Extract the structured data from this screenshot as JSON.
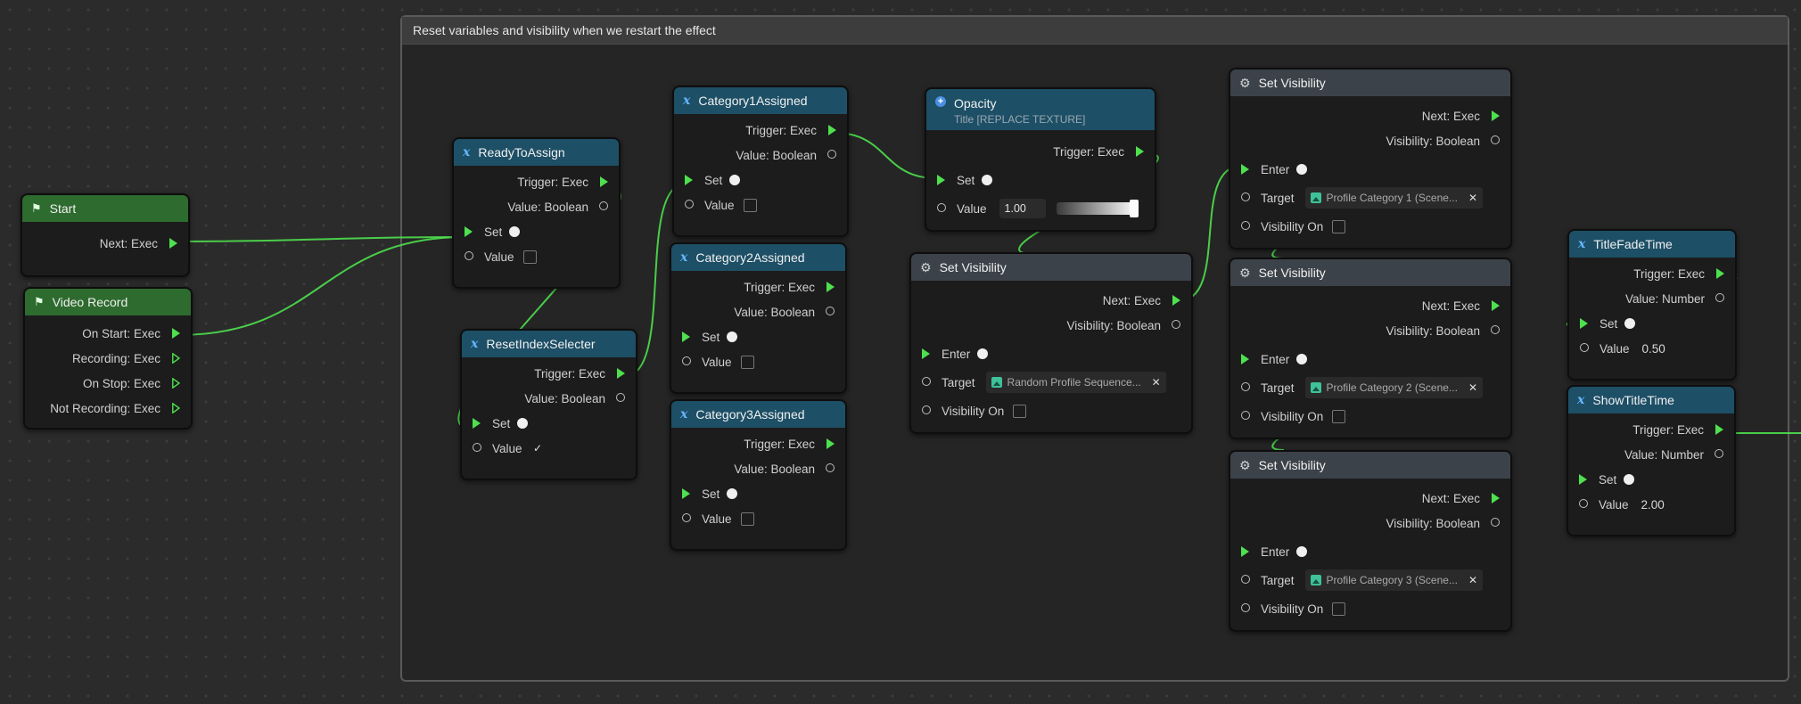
{
  "comment": {
    "title": "Reset variables and visibility when we restart the effect"
  },
  "colors": {
    "exec_pin": "#4ee04e",
    "wire": "#4ee04e",
    "header_green": "#2e6b2e",
    "header_teal": "#1d4f66",
    "header_gray": "#3c4249"
  },
  "nodes": {
    "start": {
      "title": "Start",
      "icon": "flag-icon",
      "next": "Next: Exec"
    },
    "video_record": {
      "title": "Video Record",
      "icon": "flag-icon",
      "on_start": "On Start: Exec",
      "recording": "Recording: Exec",
      "on_stop": "On Stop: Exec",
      "not_recording": "Not Recording: Exec"
    },
    "ready_to_assign": {
      "title": "ReadyToAssign",
      "trigger": "Trigger: Exec",
      "value_type": "Value: Boolean",
      "set": "Set",
      "value": "Value",
      "checked": false
    },
    "reset_index": {
      "title": "ResetIndexSelecter",
      "trigger": "Trigger: Exec",
      "value_type": "Value: Boolean",
      "set": "Set",
      "value": "Value",
      "checked": true
    },
    "cat1": {
      "title": "Category1Assigned",
      "trigger": "Trigger: Exec",
      "value_type": "Value: Boolean",
      "set": "Set",
      "value": "Value",
      "checked": false
    },
    "cat2": {
      "title": "Category2Assigned",
      "trigger": "Trigger: Exec",
      "value_type": "Value: Boolean",
      "set": "Set",
      "value": "Value",
      "checked": false
    },
    "cat3": {
      "title": "Category3Assigned",
      "trigger": "Trigger: Exec",
      "value_type": "Value: Boolean",
      "set": "Set",
      "value": "Value",
      "checked": false
    },
    "opacity": {
      "title": "Opacity",
      "subtitle": "Title [REPLACE TEXTURE]",
      "trigger": "Trigger: Exec",
      "set": "Set",
      "value": "Value",
      "value_num": "1.00",
      "slider_level": 1.0
    },
    "sv_main": {
      "title": "Set Visibility",
      "next": "Next: Exec",
      "vis_type": "Visibility: Boolean",
      "enter": "Enter",
      "target": "Target",
      "target_value": "Random Profile Sequence...",
      "vis_on": "Visibility On"
    },
    "sv1": {
      "title": "Set Visibility",
      "next": "Next: Exec",
      "vis_type": "Visibility: Boolean",
      "enter": "Enter",
      "target": "Target",
      "target_value": "Profile Category 1 (Scene...",
      "vis_on": "Visibility On"
    },
    "sv2": {
      "title": "Set Visibility",
      "next": "Next: Exec",
      "vis_type": "Visibility: Boolean",
      "enter": "Enter",
      "target": "Target",
      "target_value": "Profile Category 2 (Scene...",
      "vis_on": "Visibility On"
    },
    "sv3": {
      "title": "Set Visibility",
      "next": "Next: Exec",
      "vis_type": "Visibility: Boolean",
      "enter": "Enter",
      "target": "Target",
      "target_value": "Profile Category 3 (Scene...",
      "vis_on": "Visibility On"
    },
    "title_fade": {
      "title": "TitleFadeTime",
      "trigger": "Trigger: Exec",
      "value_type": "Value: Number",
      "set": "Set",
      "value": "Value",
      "value_num": "0.50"
    },
    "show_title": {
      "title": "ShowTitleTime",
      "trigger": "Trigger: Exec",
      "value_type": "Value: Number",
      "set": "Set",
      "value": "Value",
      "value_num": "2.00"
    }
  }
}
